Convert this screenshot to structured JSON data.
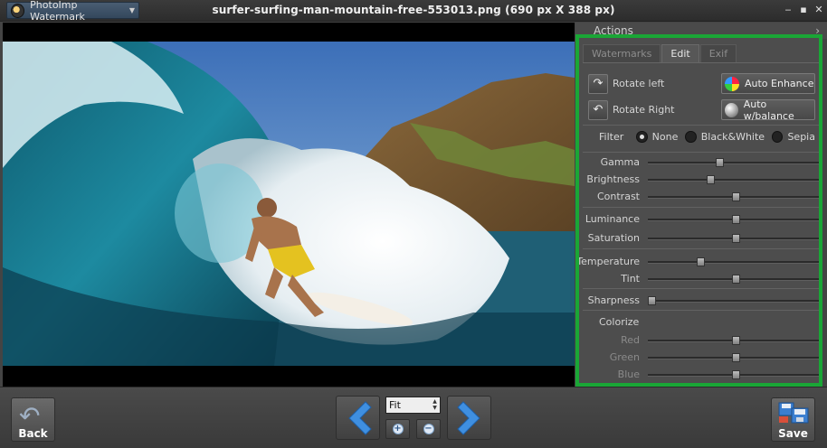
{
  "title_bar": {
    "app_name": "PhotoImp Watermark",
    "document_title": "surfer-surfing-man-mountain-free-553013.png (690 px X 388 px)",
    "window_buttons": {
      "minimize": "‒",
      "maximize": "▪",
      "close": "✕"
    }
  },
  "actions_header": {
    "label": "Actions",
    "arrow": "›"
  },
  "tabs": [
    {
      "label": "Watermarks",
      "active": false
    },
    {
      "label": "Edit",
      "active": true
    },
    {
      "label": "Exif",
      "active": false
    }
  ],
  "edit": {
    "rotate_left": "Rotate left",
    "rotate_right": "Rotate Right",
    "auto_enhance": "Auto Enhance",
    "auto_balance": "Auto w/balance",
    "filter_label": "Filter",
    "filter_options": [
      "None",
      "Black&White",
      "Sepia"
    ],
    "filter_selected": "None",
    "sliders": [
      {
        "label": "Gamma",
        "value": 0.41,
        "enabled": true
      },
      {
        "label": "Brightness",
        "value": 0.36,
        "enabled": true
      },
      {
        "label": "Contrast",
        "value": 0.5,
        "enabled": true
      },
      {
        "label": "Luminance",
        "value": 0.5,
        "enabled": true
      },
      {
        "label": "Saturation",
        "value": 0.5,
        "enabled": true
      },
      {
        "label": "Temperature",
        "value": 0.3,
        "enabled": true
      },
      {
        "label": "Tint",
        "value": 0.5,
        "enabled": true
      },
      {
        "label": "Sharpness",
        "value": 0.02,
        "enabled": true
      }
    ],
    "colorize_label": "Colorize",
    "colorize_sliders": [
      {
        "label": "Red",
        "value": 0.5,
        "enabled": false
      },
      {
        "label": "Green",
        "value": 0.5,
        "enabled": false
      },
      {
        "label": "Blue",
        "value": 0.5,
        "enabled": false
      }
    ]
  },
  "bottom_bar": {
    "back_label": "Back",
    "zoom_value": "Fit",
    "save_label": "Save"
  },
  "colors": {
    "highlight_border": "#1aa636",
    "nav_arrow": "#3f8fe0"
  }
}
